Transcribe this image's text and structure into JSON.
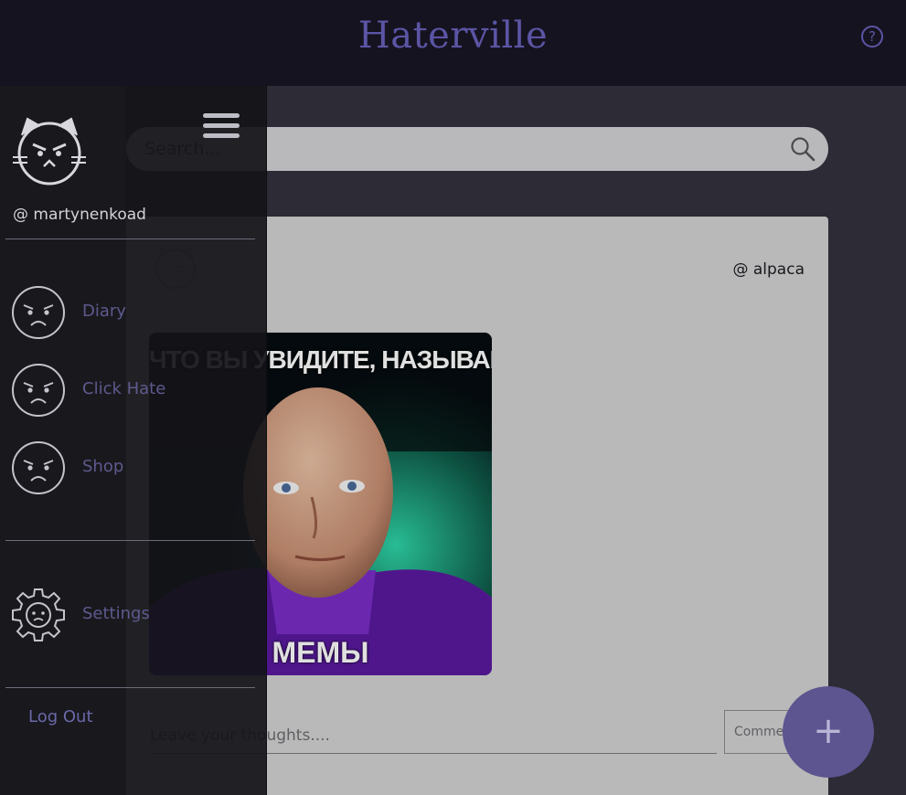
{
  "header": {
    "title": "Haterville",
    "help_label": "?"
  },
  "search": {
    "placeholder": "Search..."
  },
  "post": {
    "author": "@ alpaca",
    "image": {
      "caption_top": "ЧТО ВЫ УВИДИТЕ, НАЗЫВАЕ",
      "caption_bottom": "МЕМЫ"
    },
    "comment_placeholder": "Leave your thoughts....",
    "comment_button": "Comme..."
  },
  "sidebar": {
    "username": "@ martynenkoad",
    "items": [
      {
        "label": "Diary",
        "icon": "angry-face-icon"
      },
      {
        "label": "Click Hate",
        "icon": "angry-face-icon"
      },
      {
        "label": "Shop",
        "icon": "angry-face-icon"
      }
    ],
    "settings_label": "Settings",
    "logout_label": "Log Out"
  },
  "fab": {
    "label": "+"
  },
  "colors": {
    "accent": "#5b55a5",
    "header_bg": "#161320",
    "drawer_bg": "#19181d",
    "card_bg": "#d3d3d3",
    "fab_bg": "#5c5590"
  }
}
